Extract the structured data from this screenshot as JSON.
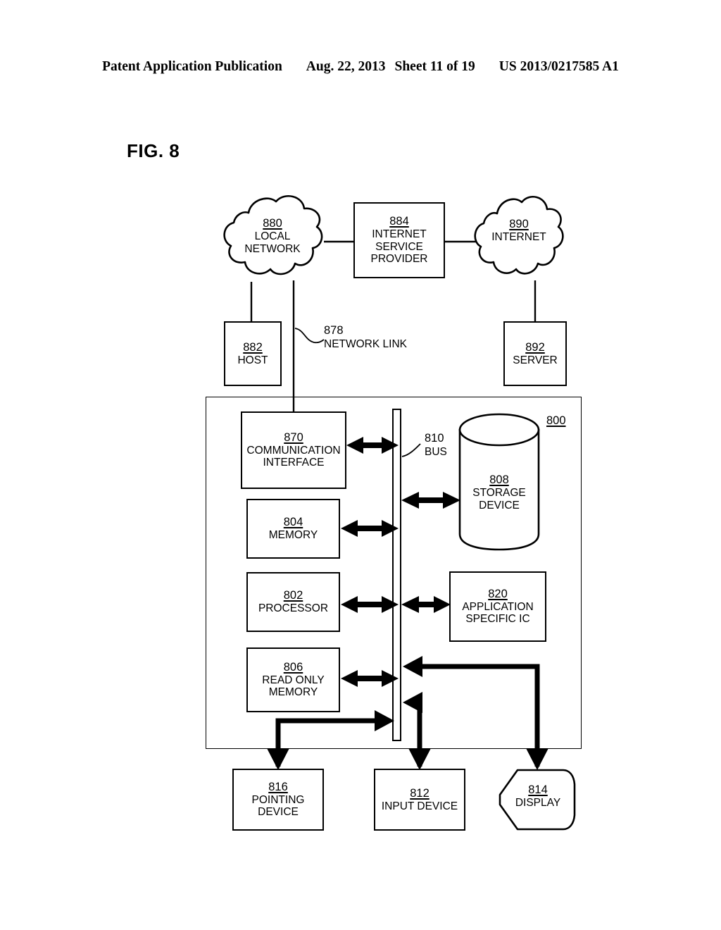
{
  "header": {
    "publication": "Patent Application Publication",
    "date": "Aug. 22, 2013",
    "sheet": "Sheet 11 of 19",
    "doc_number": "US 2013/0217585 A1"
  },
  "figure": {
    "label": "FIG. 8",
    "system_ref": "800"
  },
  "nodes": {
    "local_network": {
      "ref": "880",
      "line1": "LOCAL",
      "line2": "NETWORK"
    },
    "isp": {
      "ref": "884",
      "line1": "INTERNET",
      "line2": "SERVICE",
      "line3": "PROVIDER"
    },
    "internet": {
      "ref": "890",
      "line1": "INTERNET"
    },
    "host": {
      "ref": "882",
      "line1": "HOST"
    },
    "network_link": {
      "ref": "878",
      "line1": "NETWORK LINK"
    },
    "server": {
      "ref": "892",
      "line1": "SERVER"
    },
    "communication_interface": {
      "ref": "870",
      "line1": "COMMUNICATION",
      "line2": "INTERFACE"
    },
    "bus": {
      "ref": "810",
      "line1": "BUS"
    },
    "storage_device": {
      "ref": "808",
      "line1": "STORAGE",
      "line2": "DEVICE"
    },
    "memory": {
      "ref": "804",
      "line1": "MEMORY"
    },
    "processor": {
      "ref": "802",
      "line1": "PROCESSOR"
    },
    "asic": {
      "ref": "820",
      "line1": "APPLICATION",
      "line2": "SPECIFIC IC"
    },
    "read_only_memory": {
      "ref": "806",
      "line1": "READ ONLY",
      "line2": "MEMORY"
    },
    "pointing_device": {
      "ref": "816",
      "line1": "POINTING",
      "line2": "DEVICE"
    },
    "input_device": {
      "ref": "812",
      "line1": "INPUT DEVICE"
    },
    "display": {
      "ref": "814",
      "line1": "DISPLAY"
    }
  },
  "colors": {
    "ink": "#000000",
    "paper": "#ffffff"
  }
}
